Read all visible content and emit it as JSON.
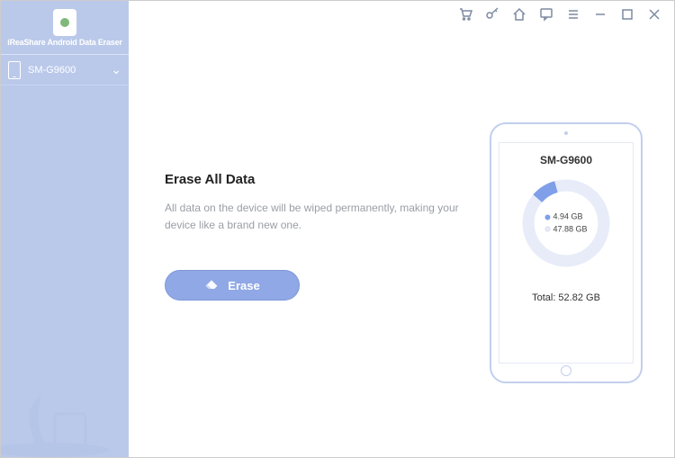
{
  "app": {
    "name": "iReaShare Android Data Eraser"
  },
  "sidebar": {
    "device": "SM-G9600"
  },
  "content": {
    "heading": "Erase All Data",
    "description": "All data on the device will be wiped permanently, making your device like a brand new one.",
    "erase_label": "Erase"
  },
  "device_panel": {
    "name": "SM-G9600",
    "used_label": "4.94 GB",
    "free_label": "47.88 GB",
    "total_label": "Total: 52.82 GB",
    "used_gb": 4.94,
    "total_gb": 52.82
  },
  "colors": {
    "sidebar_bg": "#bac9ea",
    "accent": "#90a8e5",
    "donut_used": "#7f9fe8",
    "donut_free": "#e7ecf8"
  }
}
